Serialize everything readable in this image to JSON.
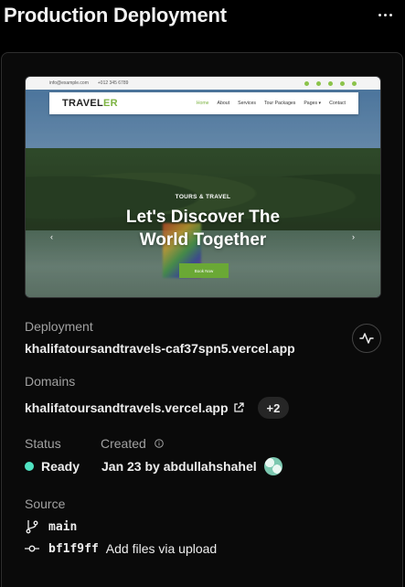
{
  "header": {
    "title": "Production Deployment"
  },
  "preview": {
    "topbar_email": "info@example.com",
    "topbar_phone": "+012 345 6789",
    "logo_dark": "TRAVEL",
    "logo_accent": "ER",
    "nav_links": [
      "Home",
      "About",
      "Services",
      "Tour Packages",
      "Pages ▾",
      "Contact"
    ],
    "kicker": "TOURS & TRAVEL",
    "headline_line1": "Let's Discover The",
    "headline_line2": "World Together",
    "cta": "Book Now"
  },
  "deployment": {
    "label": "Deployment",
    "url": "khalifatoursandtravels-caf37spn5.vercel.app"
  },
  "domains": {
    "label": "Domains",
    "primary": "khalifatoursandtravels.vercel.app",
    "extra_count": "+2"
  },
  "status": {
    "label": "Status",
    "value": "Ready",
    "color": "#50e3c2"
  },
  "created": {
    "label": "Created",
    "value": "Jan 23 by abdullahshahel"
  },
  "source": {
    "label": "Source",
    "branch": "main",
    "commit_hash": "bf1f9ff",
    "commit_message": "Add files via upload"
  }
}
